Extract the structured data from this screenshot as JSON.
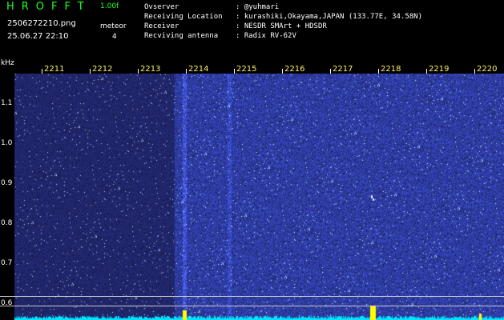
{
  "header": {
    "app_title": "HROFFT",
    "version": "1.00f",
    "filename": "2506272210.png",
    "mode": "meteor",
    "datetime": "25.06.27 22:10",
    "count": "4",
    "info": [
      {
        "label": "Ovserver",
        "value": ": @yuhmari"
      },
      {
        "label": "Receiving Location",
        "value": ": kurashiki,Okayama,JAPAN (133.77E, 34.58N)"
      },
      {
        "label": "Receiver",
        "value": ": NESDR SMArt + HDSDR"
      },
      {
        "label": "Recviving antenna",
        "value": ": Radix RV-62V"
      }
    ]
  },
  "axes": {
    "y_unit": "kHz",
    "x_ticks": [
      "2211",
      "2212",
      "2213",
      "2214",
      "2215",
      "2216",
      "2217",
      "2218",
      "2219",
      "2220"
    ],
    "y_ticks": [
      "1.1",
      "1.0",
      "0.9",
      "0.8",
      "0.7",
      "0.6"
    ]
  },
  "colors": {
    "background": "#000000",
    "title_green": "#22ff22",
    "tick_label_yellow": "#ffee66",
    "waterfall_blue": "#1a2a8c",
    "noise_floor_cyan": "#00e5ff",
    "meteor_yellow": "#ffff00"
  }
}
